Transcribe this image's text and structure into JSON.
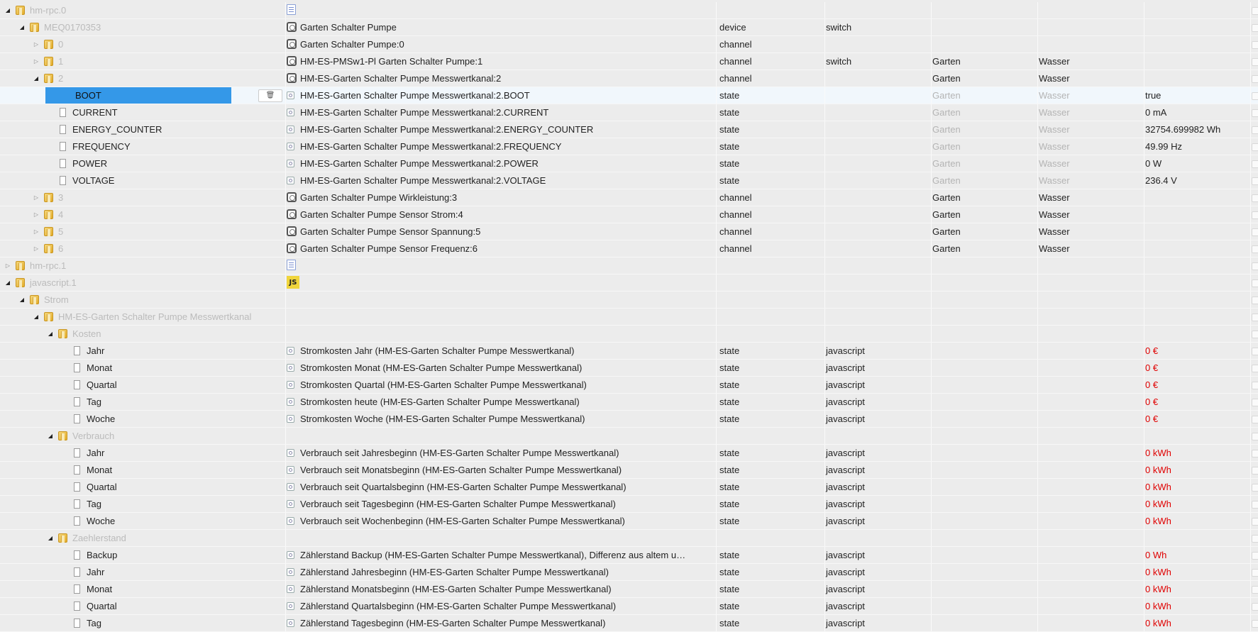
{
  "rows": [
    {
      "level": 0,
      "expand": "open",
      "icon": "folder",
      "label": "hm-rpc.0",
      "label_grey": true,
      "obj_icon": "adapter",
      "name": "",
      "type": "",
      "role": "",
      "room": "",
      "func": "",
      "value": ""
    },
    {
      "level": 1,
      "expand": "open",
      "icon": "folder",
      "label": "MEQ0170353",
      "label_grey": true,
      "obj_icon": "device",
      "name": "Garten Schalter Pumpe",
      "type": "device",
      "role": "switch",
      "room": "",
      "func": "",
      "value": ""
    },
    {
      "level": 2,
      "expand": "closed",
      "icon": "folder",
      "label": "0",
      "label_grey": true,
      "obj_icon": "channel",
      "name": "Garten Schalter Pumpe:0",
      "type": "channel",
      "role": "",
      "room": "",
      "func": "",
      "value": ""
    },
    {
      "level": 2,
      "expand": "closed",
      "icon": "folder",
      "label": "1",
      "label_grey": true,
      "obj_icon": "channel",
      "name": "HM-ES-PMSw1-Pl Garten Schalter Pumpe:1",
      "type": "channel",
      "role": "switch",
      "room": "Garten",
      "func": "Wasser",
      "value": ""
    },
    {
      "level": 2,
      "expand": "open",
      "icon": "folder",
      "label": "2",
      "label_grey": true,
      "obj_icon": "channel",
      "name": "HM-ES-Garten Schalter Pumpe Messwertkanal:2",
      "type": "channel",
      "role": "",
      "room": "Garten",
      "func": "Wasser",
      "value": ""
    },
    {
      "level": 3,
      "expand": "none",
      "icon": "file",
      "label": "BOOT",
      "selected": true,
      "delete": "🗑",
      "obj_icon": "state",
      "name": "HM-ES-Garten Schalter Pumpe Messwertkanal:2.BOOT",
      "type": "state",
      "role": "",
      "room": "Garten",
      "func": "Wasser",
      "room_dim": true,
      "value": "true"
    },
    {
      "level": 3,
      "expand": "none",
      "icon": "file",
      "label": "CURRENT",
      "obj_icon": "state",
      "name": "HM-ES-Garten Schalter Pumpe Messwertkanal:2.CURRENT",
      "type": "state",
      "role": "",
      "room": "Garten",
      "func": "Wasser",
      "room_dim": true,
      "value": "0 mA"
    },
    {
      "level": 3,
      "expand": "none",
      "icon": "file",
      "label": "ENERGY_COUNTER",
      "obj_icon": "state",
      "name": "HM-ES-Garten Schalter Pumpe Messwertkanal:2.ENERGY_COUNTER",
      "type": "state",
      "role": "",
      "room": "Garten",
      "func": "Wasser",
      "room_dim": true,
      "value": "32754.699982 Wh"
    },
    {
      "level": 3,
      "expand": "none",
      "icon": "file",
      "label": "FREQUENCY",
      "obj_icon": "state",
      "name": "HM-ES-Garten Schalter Pumpe Messwertkanal:2.FREQUENCY",
      "type": "state",
      "role": "",
      "room": "Garten",
      "func": "Wasser",
      "room_dim": true,
      "value": "49.99 Hz"
    },
    {
      "level": 3,
      "expand": "none",
      "icon": "file",
      "label": "POWER",
      "obj_icon": "state",
      "name": "HM-ES-Garten Schalter Pumpe Messwertkanal:2.POWER",
      "type": "state",
      "role": "",
      "room": "Garten",
      "func": "Wasser",
      "room_dim": true,
      "value": "0 W"
    },
    {
      "level": 3,
      "expand": "none",
      "icon": "file",
      "label": "VOLTAGE",
      "obj_icon": "state",
      "name": "HM-ES-Garten Schalter Pumpe Messwertkanal:2.VOLTAGE",
      "type": "state",
      "role": "",
      "room": "Garten",
      "func": "Wasser",
      "room_dim": true,
      "value": "236.4 V"
    },
    {
      "level": 2,
      "expand": "closed",
      "icon": "folder",
      "label": "3",
      "label_grey": true,
      "obj_icon": "channel",
      "name": "Garten Schalter Pumpe Wirkleistung:3",
      "type": "channel",
      "role": "",
      "room": "Garten",
      "func": "Wasser",
      "value": ""
    },
    {
      "level": 2,
      "expand": "closed",
      "icon": "folder",
      "label": "4",
      "label_grey": true,
      "obj_icon": "channel",
      "name": "Garten Schalter Pumpe Sensor Strom:4",
      "type": "channel",
      "role": "",
      "room": "Garten",
      "func": "Wasser",
      "value": ""
    },
    {
      "level": 2,
      "expand": "closed",
      "icon": "folder",
      "label": "5",
      "label_grey": true,
      "obj_icon": "channel",
      "name": "Garten Schalter Pumpe Sensor Spannung:5",
      "type": "channel",
      "role": "",
      "room": "Garten",
      "func": "Wasser",
      "value": ""
    },
    {
      "level": 2,
      "expand": "closed",
      "icon": "folder",
      "label": "6",
      "label_grey": true,
      "obj_icon": "channel",
      "name": "Garten Schalter Pumpe Sensor Frequenz:6",
      "type": "channel",
      "role": "",
      "room": "Garten",
      "func": "Wasser",
      "value": ""
    },
    {
      "level": 0,
      "expand": "closed",
      "icon": "folder",
      "label": "hm-rpc.1",
      "label_grey": true,
      "obj_icon": "adapter",
      "name": "",
      "type": "",
      "role": "",
      "room": "",
      "func": "",
      "value": ""
    },
    {
      "level": 0,
      "expand": "open",
      "icon": "folder",
      "label": "javascript.1",
      "label_grey": true,
      "obj_icon": "js",
      "obj_text": "JS",
      "name": "",
      "type": "",
      "role": "",
      "room": "",
      "func": "",
      "value": ""
    },
    {
      "level": 1,
      "expand": "open",
      "icon": "folder",
      "label": "Strom",
      "label_grey": true,
      "obj_icon": "",
      "name": "",
      "type": "",
      "role": "",
      "room": "",
      "func": "",
      "value": ""
    },
    {
      "level": 2,
      "expand": "open",
      "icon": "folder",
      "label": "HM-ES-Garten Schalter Pumpe Messwertkanal",
      "label_grey": true,
      "obj_icon": "",
      "name": "",
      "type": "",
      "role": "",
      "room": "",
      "func": "",
      "value": ""
    },
    {
      "level": 3,
      "expand": "open",
      "icon": "folder",
      "label": "Kosten",
      "label_grey": true,
      "obj_icon": "",
      "name": "",
      "type": "",
      "role": "",
      "room": "",
      "func": "",
      "value": ""
    },
    {
      "level": 4,
      "expand": "none",
      "icon": "file",
      "label": "Jahr",
      "obj_icon": "state",
      "name": "Stromkosten Jahr (HM-ES-Garten Schalter Pumpe Messwertkanal)",
      "type": "state",
      "role": "javascript",
      "room": "",
      "func": "",
      "value": "0 €",
      "value_red": true
    },
    {
      "level": 4,
      "expand": "none",
      "icon": "file",
      "label": "Monat",
      "obj_icon": "state",
      "name": "Stromkosten Monat (HM-ES-Garten Schalter Pumpe Messwertkanal)",
      "type": "state",
      "role": "javascript",
      "room": "",
      "func": "",
      "value": "0 €",
      "value_red": true
    },
    {
      "level": 4,
      "expand": "none",
      "icon": "file",
      "label": "Quartal",
      "obj_icon": "state",
      "name": "Stromkosten Quartal (HM-ES-Garten Schalter Pumpe Messwertkanal)",
      "type": "state",
      "role": "javascript",
      "room": "",
      "func": "",
      "value": "0 €",
      "value_red": true
    },
    {
      "level": 4,
      "expand": "none",
      "icon": "file",
      "label": "Tag",
      "obj_icon": "state",
      "name": "Stromkosten heute (HM-ES-Garten Schalter Pumpe Messwertkanal)",
      "type": "state",
      "role": "javascript",
      "room": "",
      "func": "",
      "value": "0 €",
      "value_red": true
    },
    {
      "level": 4,
      "expand": "none",
      "icon": "file",
      "label": "Woche",
      "obj_icon": "state",
      "name": "Stromkosten Woche (HM-ES-Garten Schalter Pumpe Messwertkanal)",
      "type": "state",
      "role": "javascript",
      "room": "",
      "func": "",
      "value": "0 €",
      "value_red": true
    },
    {
      "level": 3,
      "expand": "open",
      "icon": "folder",
      "label": "Verbrauch",
      "label_grey": true,
      "obj_icon": "",
      "name": "",
      "type": "",
      "role": "",
      "room": "",
      "func": "",
      "value": ""
    },
    {
      "level": 4,
      "expand": "none",
      "icon": "file",
      "label": "Jahr",
      "obj_icon": "state",
      "name": "Verbrauch seit Jahresbeginn (HM-ES-Garten Schalter Pumpe Messwertkanal)",
      "type": "state",
      "role": "javascript",
      "room": "",
      "func": "",
      "value": "0 kWh",
      "value_red": true
    },
    {
      "level": 4,
      "expand": "none",
      "icon": "file",
      "label": "Monat",
      "obj_icon": "state",
      "name": "Verbrauch seit Monatsbeginn (HM-ES-Garten Schalter Pumpe Messwertkanal)",
      "type": "state",
      "role": "javascript",
      "room": "",
      "func": "",
      "value": "0 kWh",
      "value_red": true
    },
    {
      "level": 4,
      "expand": "none",
      "icon": "file",
      "label": "Quartal",
      "obj_icon": "state",
      "name": "Verbrauch seit Quartalsbeginn (HM-ES-Garten Schalter Pumpe Messwertkanal)",
      "type": "state",
      "role": "javascript",
      "room": "",
      "func": "",
      "value": "0 kWh",
      "value_red": true
    },
    {
      "level": 4,
      "expand": "none",
      "icon": "file",
      "label": "Tag",
      "obj_icon": "state",
      "name": "Verbrauch seit Tagesbeginn (HM-ES-Garten Schalter Pumpe Messwertkanal)",
      "type": "state",
      "role": "javascript",
      "room": "",
      "func": "",
      "value": "0 kWh",
      "value_red": true
    },
    {
      "level": 4,
      "expand": "none",
      "icon": "file",
      "label": "Woche",
      "obj_icon": "state",
      "name": "Verbrauch seit Wochenbeginn (HM-ES-Garten Schalter Pumpe Messwertkanal)",
      "type": "state",
      "role": "javascript",
      "room": "",
      "func": "",
      "value": "0 kWh",
      "value_red": true
    },
    {
      "level": 3,
      "expand": "open",
      "icon": "folder",
      "label": "Zaehlerstand",
      "label_grey": true,
      "obj_icon": "",
      "name": "",
      "type": "",
      "role": "",
      "room": "",
      "func": "",
      "value": ""
    },
    {
      "level": 4,
      "expand": "none",
      "icon": "file",
      "label": "Backup",
      "obj_icon": "state",
      "name": "Zählerstand Backup (HM-ES-Garten Schalter Pumpe Messwertkanal), Differenz aus altem u…",
      "type": "state",
      "role": "javascript",
      "room": "",
      "func": "",
      "value": "0 Wh",
      "value_red": true
    },
    {
      "level": 4,
      "expand": "none",
      "icon": "file",
      "label": "Jahr",
      "obj_icon": "state",
      "name": "Zählerstand Jahresbeginn (HM-ES-Garten Schalter Pumpe Messwertkanal)",
      "type": "state",
      "role": "javascript",
      "room": "",
      "func": "",
      "value": "0 kWh",
      "value_red": true
    },
    {
      "level": 4,
      "expand": "none",
      "icon": "file",
      "label": "Monat",
      "obj_icon": "state",
      "name": "Zählerstand Monatsbeginn (HM-ES-Garten Schalter Pumpe Messwertkanal)",
      "type": "state",
      "role": "javascript",
      "room": "",
      "func": "",
      "value": "0 kWh",
      "value_red": true
    },
    {
      "level": 4,
      "expand": "none",
      "icon": "file",
      "label": "Quartal",
      "obj_icon": "state",
      "name": "Zählerstand Quartalsbeginn (HM-ES-Garten Schalter Pumpe Messwertkanal)",
      "type": "state",
      "role": "javascript",
      "room": "",
      "func": "",
      "value": "0 kWh",
      "value_red": true
    },
    {
      "level": 4,
      "expand": "none",
      "icon": "file",
      "label": "Tag",
      "obj_icon": "state",
      "name": "Zählerstand Tagesbeginn (HM-ES-Garten Schalter Pumpe Messwertkanal)",
      "type": "state",
      "role": "javascript",
      "room": "",
      "func": "",
      "value": "0 kWh",
      "value_red": true
    }
  ]
}
